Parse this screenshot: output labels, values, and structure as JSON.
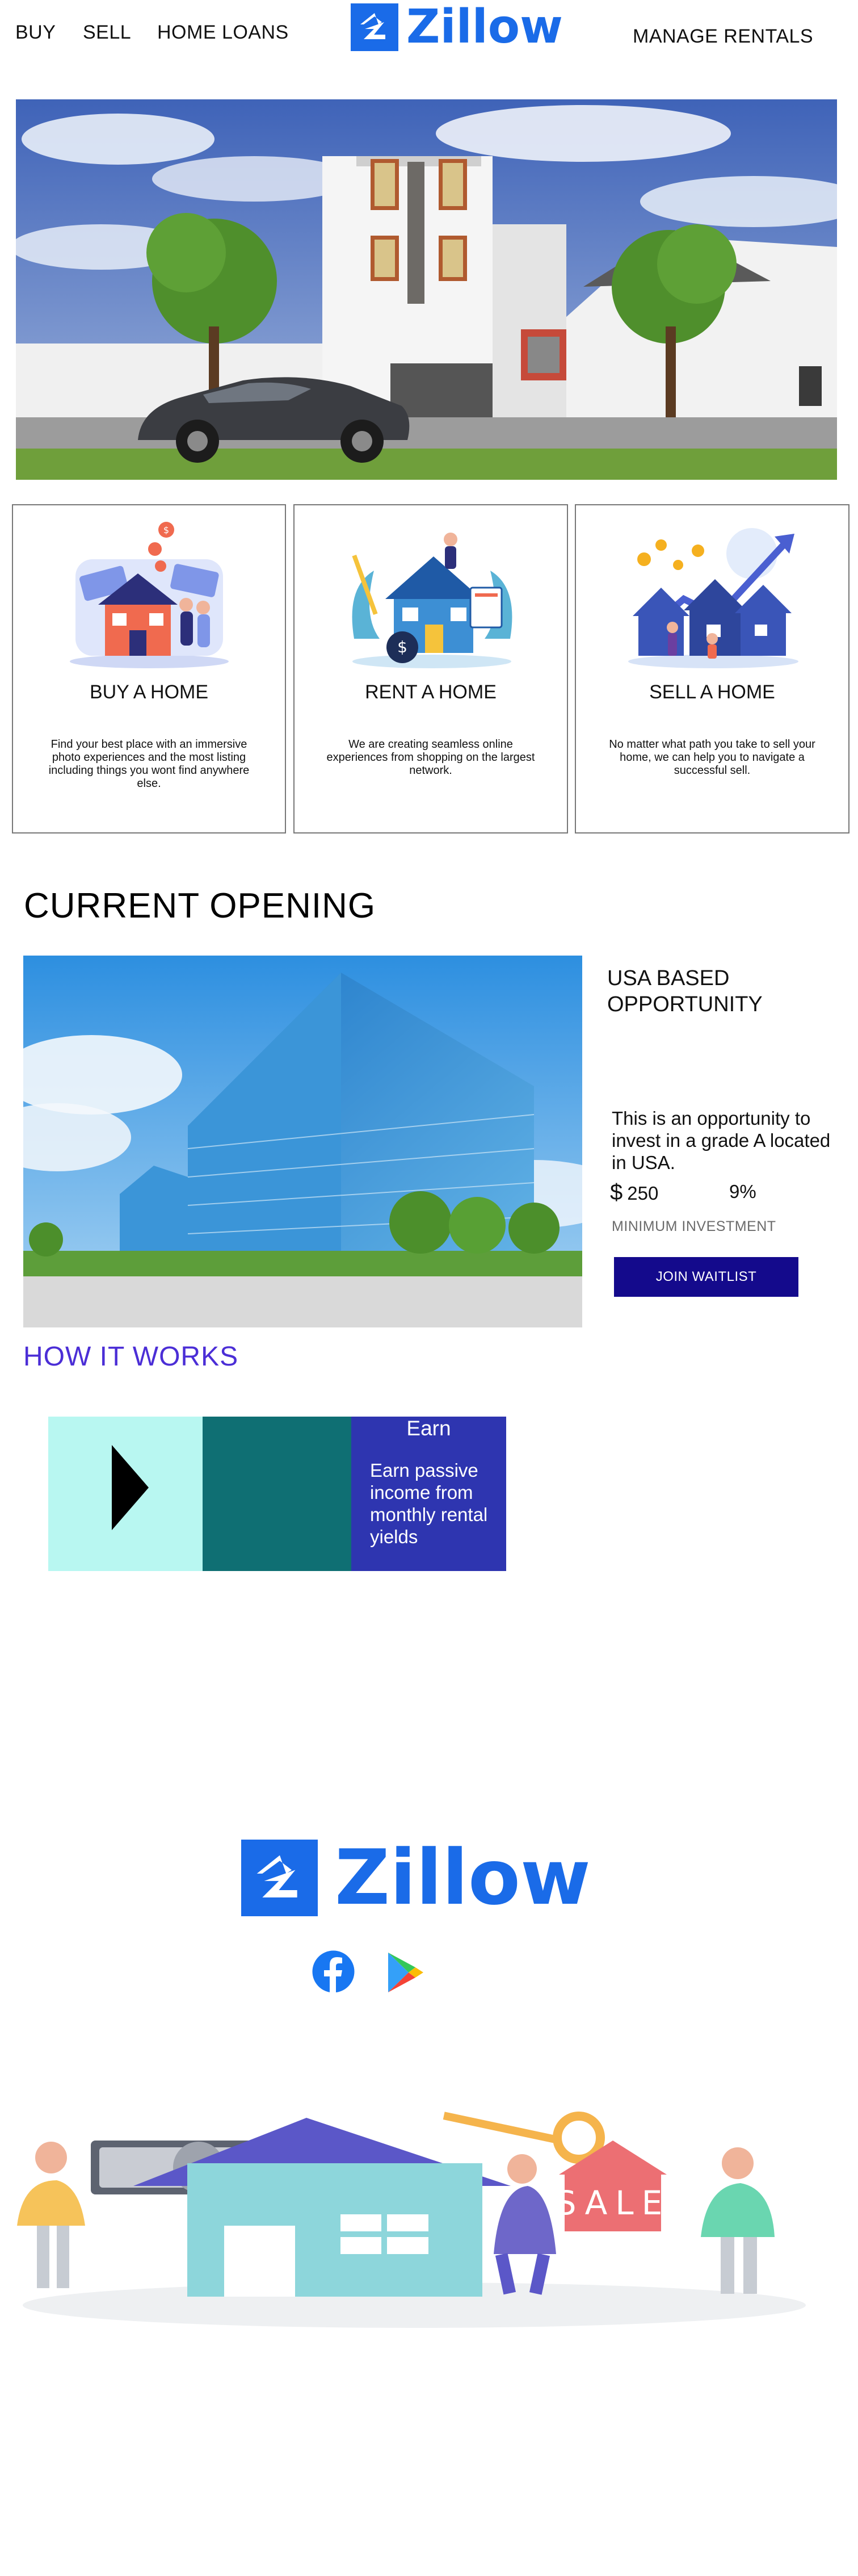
{
  "nav": {
    "buy": "BUY",
    "sell": "SELL",
    "home_loans": "HOME LOANS",
    "manage_rentals": "MANAGE RENTALS"
  },
  "brand": {
    "name": "Zillow",
    "color": "#1a6be8"
  },
  "cards": [
    {
      "title": "BUY A HOME",
      "description": "Find your best place with an immersive photo experiences and the most listing including things you wont find anywhere else.",
      "icon": "buy-home-illustration"
    },
    {
      "title": "RENT A HOME",
      "description": "We are creating seamless  online experiences from  shopping on the largest network.",
      "icon": "rent-home-illustration"
    },
    {
      "title": "SELL A HOME",
      "description": "No matter what path you  take to sell your home, we can help you to navigate a successful sell.",
      "icon": "sell-home-illustration"
    }
  ],
  "opening": {
    "heading": "CURRENT OPENING",
    "title": "USA BASED OPPORTUNITY",
    "description": "This is an opportunity to invest in a grade A located in USA.",
    "currency": "$",
    "amount": "250",
    "percent": "9%",
    "min_label": "MINIMUM INVESTMENT",
    "cta": "JOIN WAITLIST",
    "cta_color": "#140a8c"
  },
  "how": {
    "heading": "HOW IT WORKS",
    "heading_color": "#4b2ed6",
    "earn_title": "Earn",
    "earn_desc": "Earn passive income from monthly rental yields"
  },
  "footer": {
    "brand": "Zillow",
    "social": [
      "facebook-icon",
      "google-play-icon"
    ],
    "sale_sign": "SALE"
  }
}
